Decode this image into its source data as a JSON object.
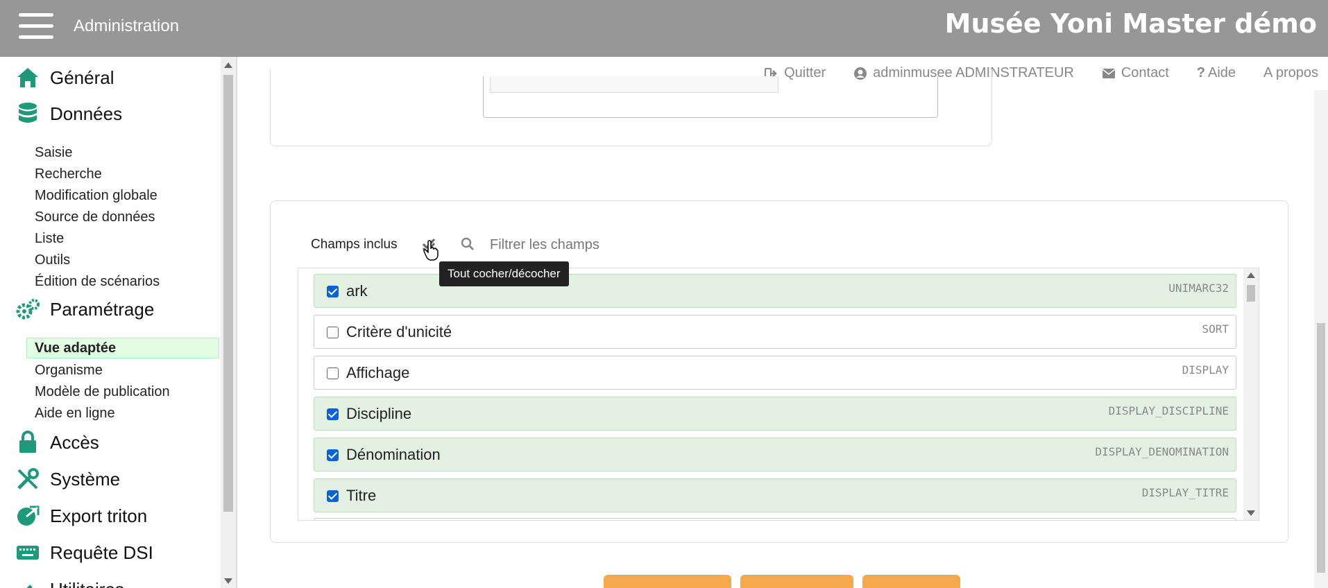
{
  "header": {
    "app_title": "Administration",
    "site_title": "Musée Yoni Master démo"
  },
  "topnav": {
    "quit": "Quitter",
    "user": "adminmusee ADMINSTRATEUR",
    "contact": "Contact",
    "help": "Aide",
    "about": "A propos"
  },
  "sidebar": {
    "general": "Général",
    "data": "Données",
    "data_items": [
      "Saisie",
      "Recherche",
      "Modification globale",
      "Source de données",
      "Liste",
      "Outils",
      "Édition de scénarios"
    ],
    "settings": "Paramétrage",
    "settings_items": [
      "Vue adaptée",
      "Organisme",
      "Modèle de publication",
      "Aide en ligne"
    ],
    "access": "Accès",
    "system": "Système",
    "export": "Export triton",
    "dsi": "Requête DSI",
    "utilities": "Utilitaires"
  },
  "fields_panel": {
    "label": "Champs inclus",
    "tooltip": "Tout cocher/décocher",
    "filter_placeholder": "Filtrer les champs",
    "rows": [
      {
        "label": "ark",
        "code": "UNIMARC32",
        "checked": true
      },
      {
        "label": "Critère d'unicité",
        "code": "SORT",
        "checked": false
      },
      {
        "label": "Affichage",
        "code": "DISPLAY",
        "checked": false
      },
      {
        "label": "Discipline",
        "code": "DISPLAY_DISCIPLINE",
        "checked": true
      },
      {
        "label": "Dénomination",
        "code": "DISPLAY_DENOMINATION",
        "checked": true
      },
      {
        "label": "Titre",
        "code": "DISPLAY_TITRE",
        "checked": true
      }
    ]
  },
  "colors": {
    "topbar": "#979797",
    "accent_icon": "#1e9a7a",
    "checked_row": "#e2f1e2",
    "button": "#f6a94a"
  }
}
